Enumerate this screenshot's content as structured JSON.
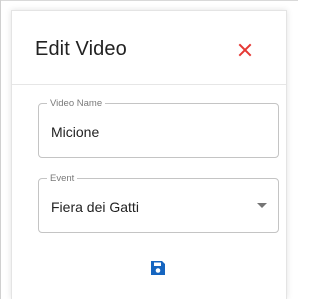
{
  "dialog": {
    "title": "Edit Video",
    "close_icon": "close-icon",
    "save_icon": "save-icon",
    "accent_color": "#1565c0",
    "close_color": "#e53935"
  },
  "fields": {
    "video_name": {
      "label": "Video Name",
      "value": "Micione"
    },
    "event": {
      "label": "Event",
      "value": "Fiera dei Gatti",
      "dropdown_icon": "chevron-down-icon"
    }
  }
}
